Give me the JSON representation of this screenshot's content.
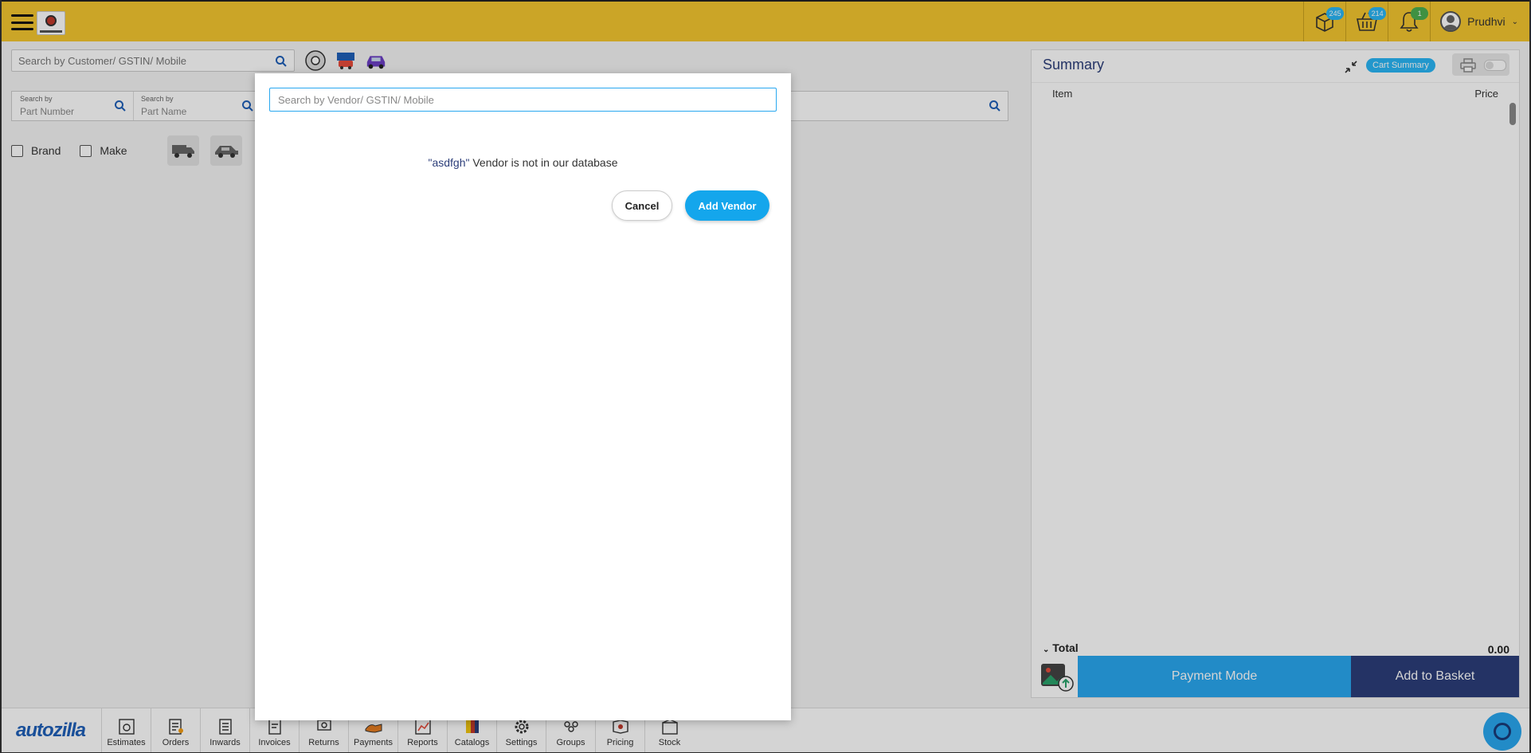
{
  "header": {
    "user_name": "Prudhvi",
    "badges": {
      "packages": "245",
      "basket": "214",
      "notifications": "1"
    }
  },
  "search": {
    "customer_placeholder": "Search by Customer/ GSTIN/ Mobile",
    "part_number_label": "Search by",
    "part_number_value": "Part Number",
    "part_name_label": "Search by",
    "part_name_value": "Part Name"
  },
  "filters": {
    "brand": "Brand",
    "make": "Make"
  },
  "summary": {
    "title": "Summary",
    "cart_summary": "Cart Summary",
    "col_item": "Item",
    "col_price": "Price",
    "total_label": "Total",
    "total_value": "0.00",
    "payment_mode": "Payment Mode",
    "add_to_basket": "Add to Basket"
  },
  "bottom_nav": {
    "brand": "autozilla",
    "items": [
      "Estimates",
      "Orders",
      "Inwards",
      "Invoices",
      "Returns",
      "Payments",
      "Reports",
      "Catalogs",
      "Settings",
      "Groups",
      "Pricing",
      "Stock"
    ]
  },
  "modal": {
    "search_placeholder": "Search by Vendor/ GSTIN/ Mobile",
    "query_text": "\"asdfgh\"",
    "not_found_text": " Vendor is not in our database",
    "cancel": "Cancel",
    "add_vendor": "Add Vendor"
  },
  "colors": {
    "accent": "#f5c730",
    "primary": "#29a8f0",
    "navy": "#2c3e7a"
  }
}
